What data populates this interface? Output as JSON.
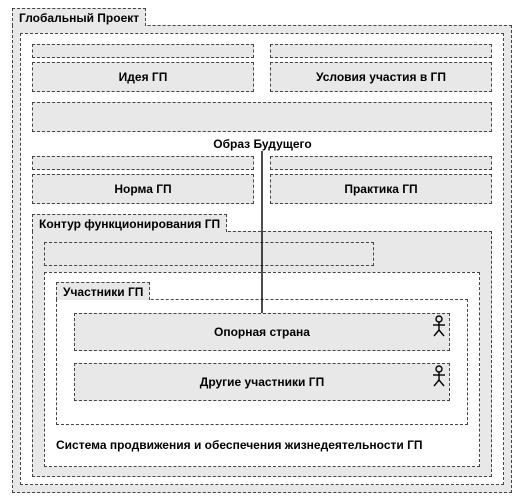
{
  "title": "Глобальный Проект",
  "row1": {
    "idea": "Идея ГП",
    "conditions": "Условия участия в ГП"
  },
  "center": "Образ Будущего",
  "row2": {
    "norm": "Норма ГП",
    "practice": "Практика ГП"
  },
  "loop": {
    "title": "Контур функционирования ГП"
  },
  "participants": {
    "title": "Участники ГП",
    "anchor": "Опорная страна",
    "others": "Другие участники ГП"
  },
  "system": "Система продвижения и обеспечения жизнедеятельности ГП"
}
